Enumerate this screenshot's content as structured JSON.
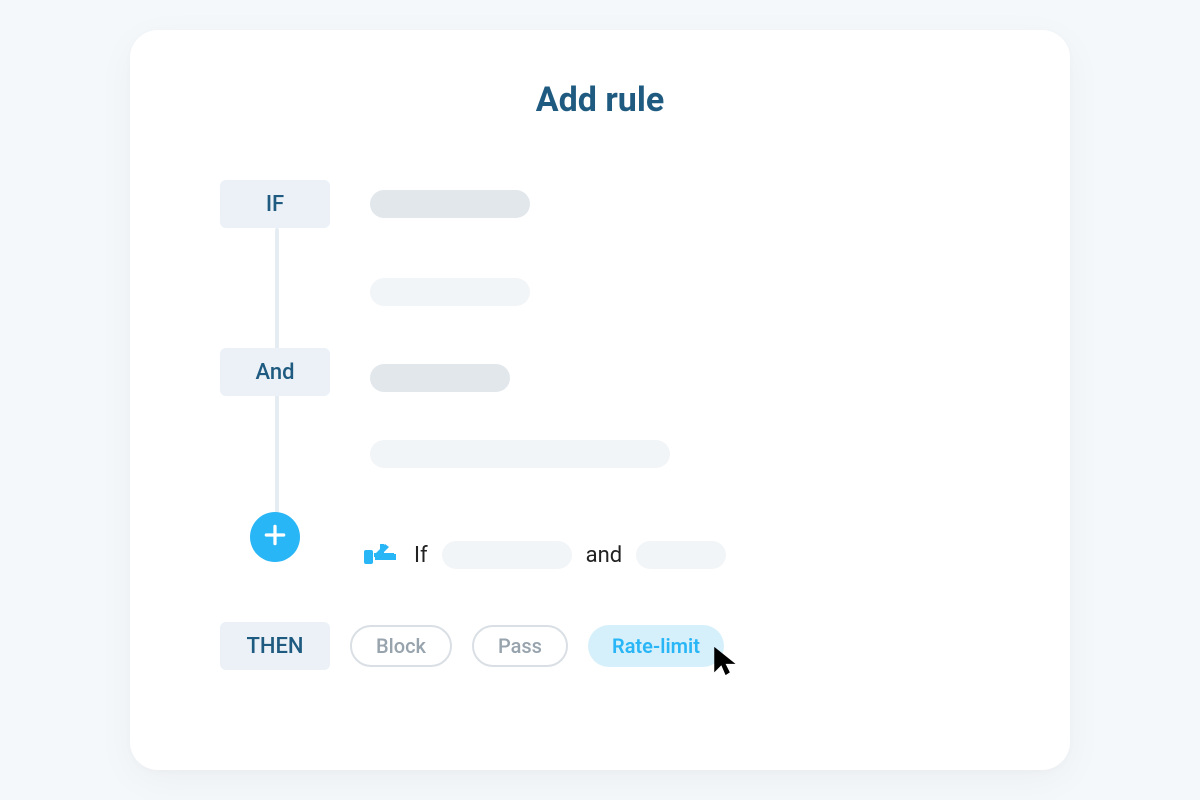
{
  "title": "Add rule",
  "conditions": {
    "if_label": "IF",
    "and_label": "And"
  },
  "summary": {
    "if_text": "If",
    "and_text": "and"
  },
  "then": {
    "label": "THEN",
    "actions": {
      "block": "Block",
      "pass": "Pass",
      "rate_limit": "Rate-limit"
    }
  },
  "icons": {
    "add": "plus-icon",
    "hint": "pointing-hand-icon",
    "cursor": "cursor-icon"
  },
  "colors": {
    "accent": "#29b6f6",
    "heading": "#1f5b80",
    "badge_bg": "#ebf1f6"
  }
}
